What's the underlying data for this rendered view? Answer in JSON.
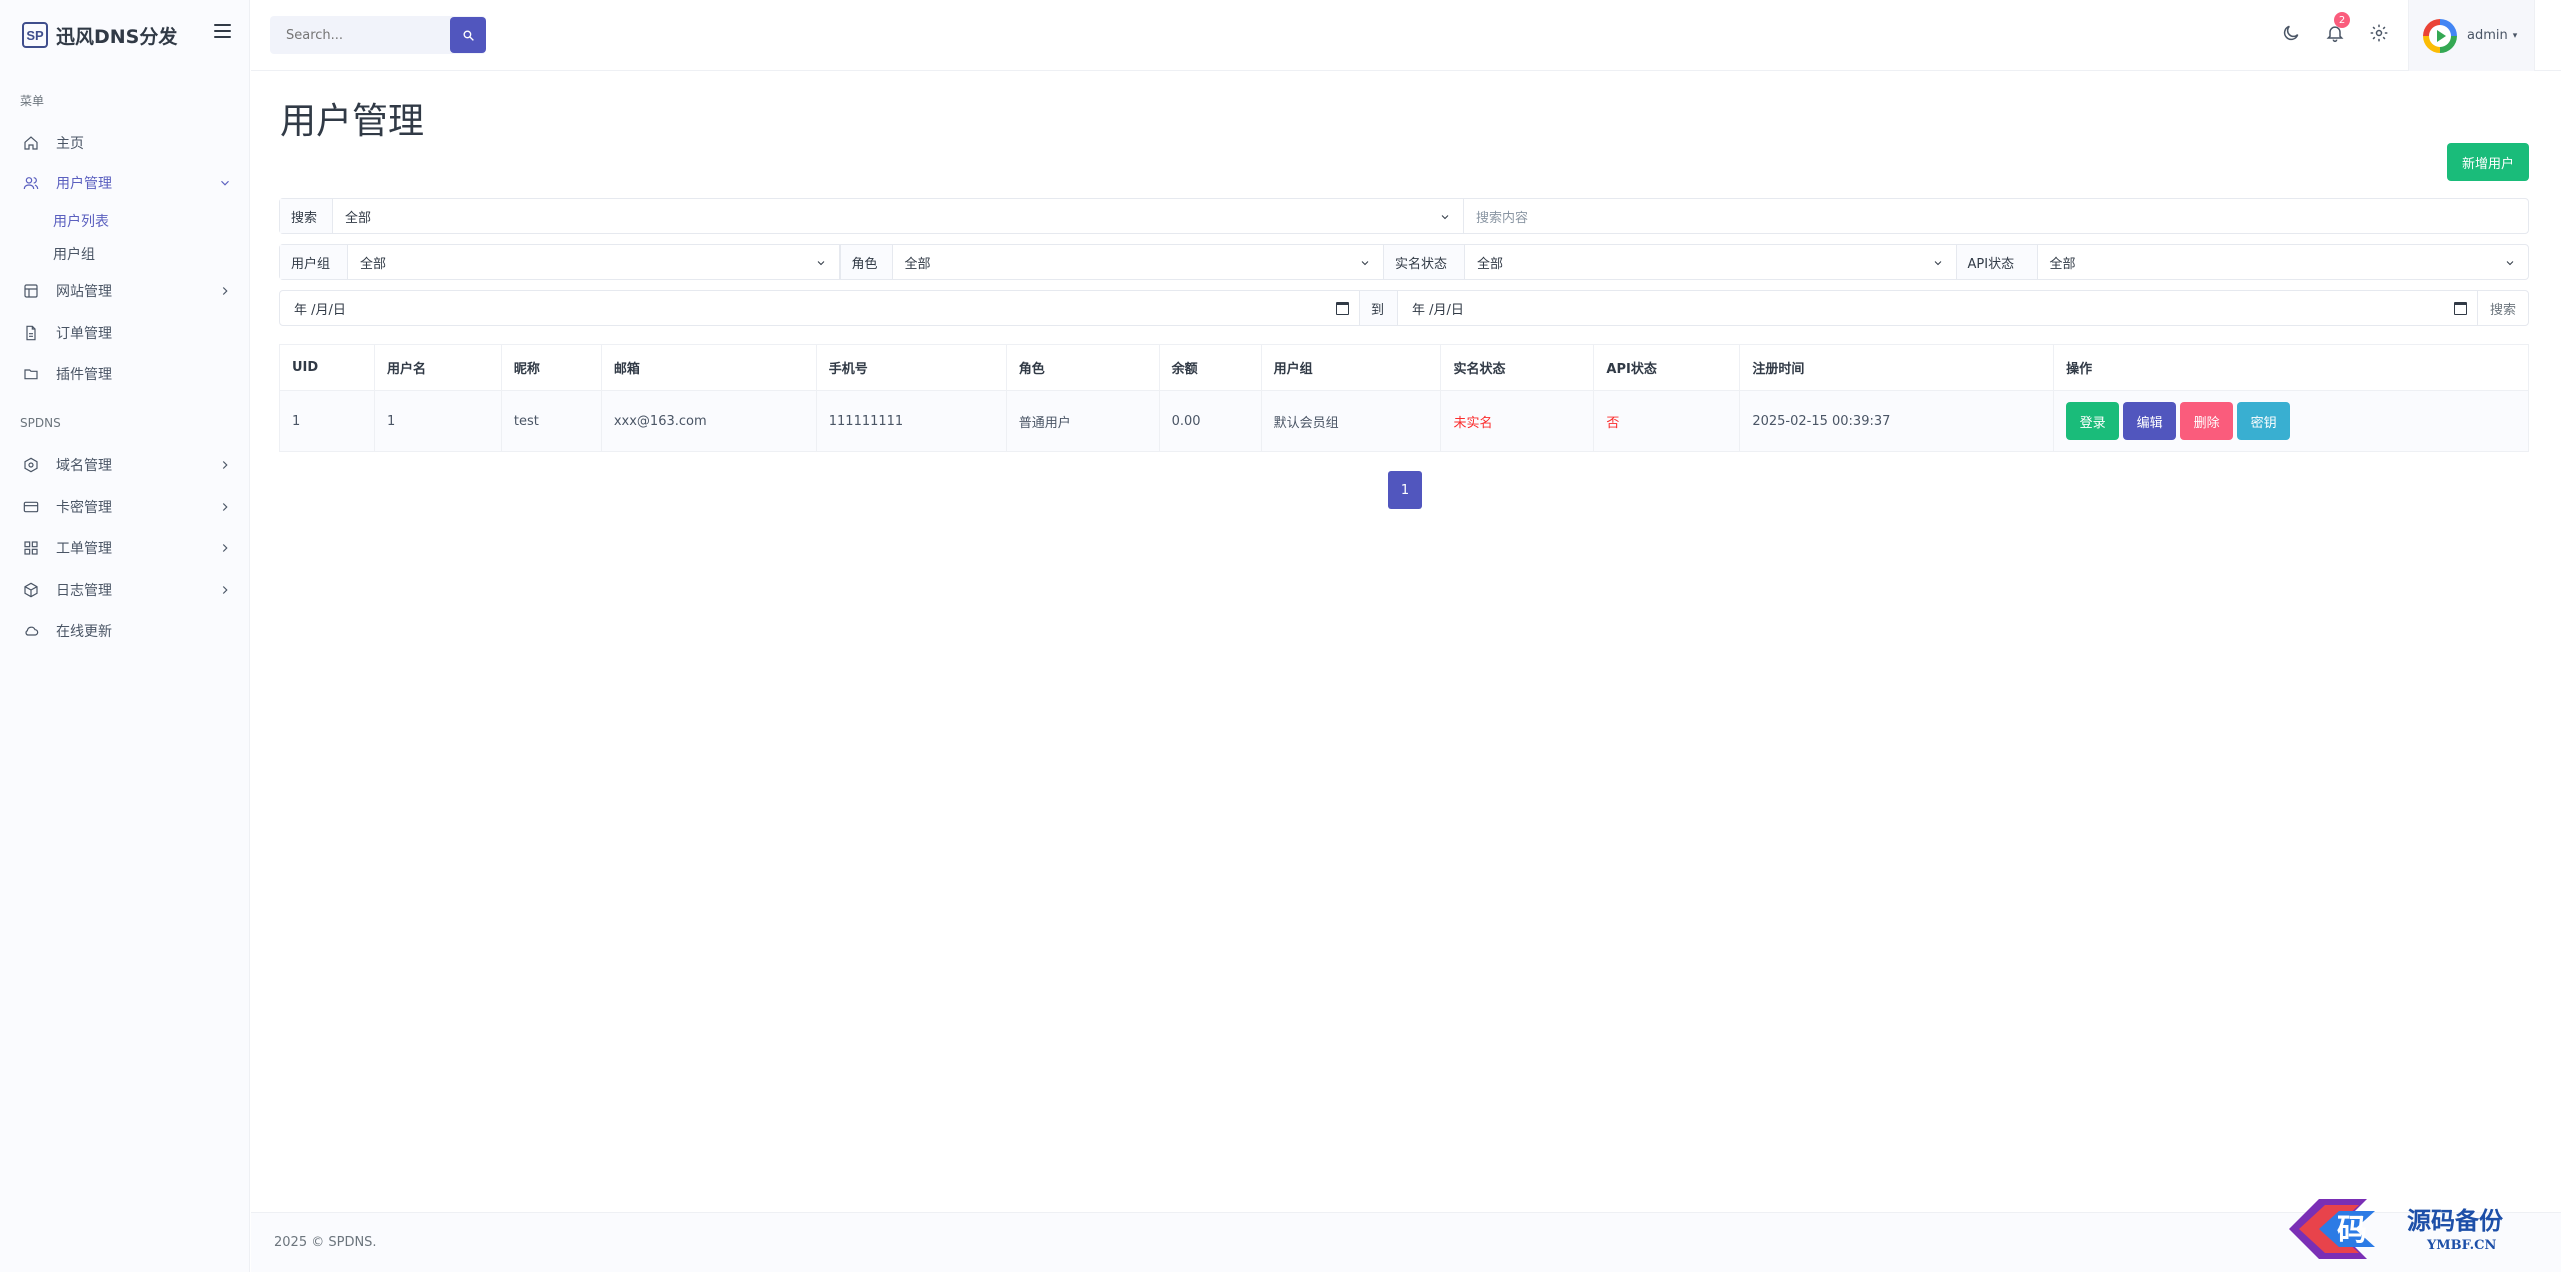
{
  "brand": {
    "logo": "SP",
    "name": "迅风DNS分发"
  },
  "sidebar": {
    "section_menu": "菜单",
    "section_spdns": "SPDNS",
    "items": [
      {
        "label": "主页",
        "icon": "home-icon"
      },
      {
        "label": "用户管理",
        "icon": "users-icon",
        "active": true
      },
      {
        "label": "网站管理",
        "icon": "layout-icon"
      },
      {
        "label": "订单管理",
        "icon": "file-icon"
      },
      {
        "label": "插件管理",
        "icon": "folder-icon"
      },
      {
        "label": "域名管理",
        "icon": "hexagon-icon"
      },
      {
        "label": "卡密管理",
        "icon": "card-icon"
      },
      {
        "label": "工单管理",
        "icon": "grid-icon"
      },
      {
        "label": "日志管理",
        "icon": "box-icon"
      },
      {
        "label": "在线更新",
        "icon": "cloud-icon"
      }
    ],
    "subitems": [
      {
        "label": "用户列表",
        "active": true
      },
      {
        "label": "用户组"
      }
    ]
  },
  "topbar": {
    "search_placeholder": "Search...",
    "notification_count": "2",
    "user_name": "admin"
  },
  "page": {
    "title": "用户管理",
    "add_button": "新增用户"
  },
  "filters": {
    "search_label": "搜索",
    "search_field_value": "全部",
    "search_content_placeholder": "搜索内容",
    "group_label": "用户组",
    "group_value": "全部",
    "role_label": "角色",
    "role_value": "全部",
    "realname_label": "实名状态",
    "realname_value": "全部",
    "api_label": "API状态",
    "api_value": "全部",
    "date_from": "年 /月/日",
    "date_to_label": "到",
    "date_to": "年 /月/日",
    "search_button": "搜索"
  },
  "table": {
    "headers": [
      "UID",
      "用户名",
      "昵称",
      "邮箱",
      "手机号",
      "角色",
      "余额",
      "用户组",
      "实名状态",
      "API状态",
      "注册时间",
      "操作"
    ],
    "rows": [
      {
        "uid": "1",
        "username": "1",
        "nickname": "test",
        "email": "xxx@163.com",
        "phone": "111111111",
        "role": "普通用户",
        "balance": "0.00",
        "group": "默认会员组",
        "realname": "未实名",
        "api": "否",
        "registered": "2025-02-15 00:39:37"
      }
    ],
    "actions": {
      "login": "登录",
      "edit": "编辑",
      "delete": "删除",
      "key": "密钥"
    }
  },
  "pagination": {
    "current": "1"
  },
  "footer": {
    "text": "2025 © SPDNS."
  },
  "watermark": {
    "text": "源码备份",
    "sub": "YMBF.CN",
    "mark": "码"
  },
  "colors": {
    "primary": "#5156be",
    "success": "#1abc7a",
    "danger": "#fa5c7c",
    "info": "#39afd1",
    "alert_text": "#fa2c2c"
  }
}
